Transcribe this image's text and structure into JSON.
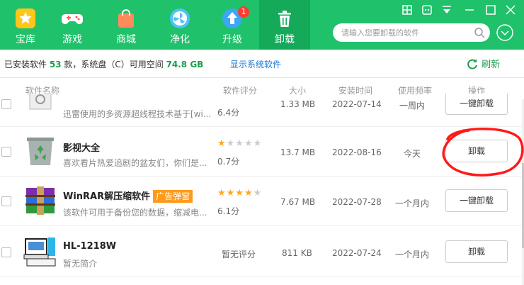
{
  "toolbar": {
    "tabs": [
      {
        "label": "宝库",
        "icon": "treasure-star-icon"
      },
      {
        "label": "游戏",
        "icon": "gamepad-icon"
      },
      {
        "label": "商城",
        "icon": "shopping-bag-icon"
      },
      {
        "label": "净化",
        "icon": "purify-fan-icon"
      },
      {
        "label": "升级",
        "icon": "upgrade-arrow-icon",
        "badge": "1"
      },
      {
        "label": "卸载",
        "icon": "trash-icon",
        "active": true
      }
    ],
    "search_placeholder": "请输入您要卸载的软件",
    "colors": {
      "primary": "#1fc16b",
      "active_tab": "#15a95a"
    }
  },
  "infobar": {
    "text_prefix": "已安装软件 ",
    "installed_count": "53",
    "text_mid": " 款，系统盘（C）可用空间 ",
    "free_space": "74.8 GB",
    "show_system_link": "显示系统软件",
    "refresh_label": "刷新"
  },
  "table": {
    "headers": [
      "软件名称",
      "软件评分",
      "大小",
      "安装时间",
      "使用频率",
      "操作"
    ],
    "rows": [
      {
        "name": "",
        "desc": "迅雷使用的多资源超线程技术基于[wi...",
        "score": "6.4分",
        "size": "1.33 MB",
        "date": "2022-07-14",
        "freq": "一周内",
        "action": "一键卸载"
      },
      {
        "name": "影视大全",
        "desc": "喜欢看片热爱追剧的盆友们，你们是...",
        "stars": 1,
        "score": "0.7分",
        "size": "13.7 MB",
        "date": "2022-08-16",
        "freq": "今天",
        "action": "卸载"
      },
      {
        "name": "WinRAR解压缩软件",
        "ad_tag": "广告弹窗",
        "desc": "该软件可用于备份您的数据，缩减电...",
        "stars": 3.5,
        "score": "6.1分",
        "size": "7.67 MB",
        "date": "2022-07-28",
        "freq": "一个月内",
        "action": "一键卸载"
      },
      {
        "name": "HL-1218W",
        "desc": "暂无简介",
        "score": "暂无评分",
        "size": "811 KB",
        "date": "2022-07-24",
        "freq": "一个月内",
        "action": "卸载"
      }
    ]
  }
}
